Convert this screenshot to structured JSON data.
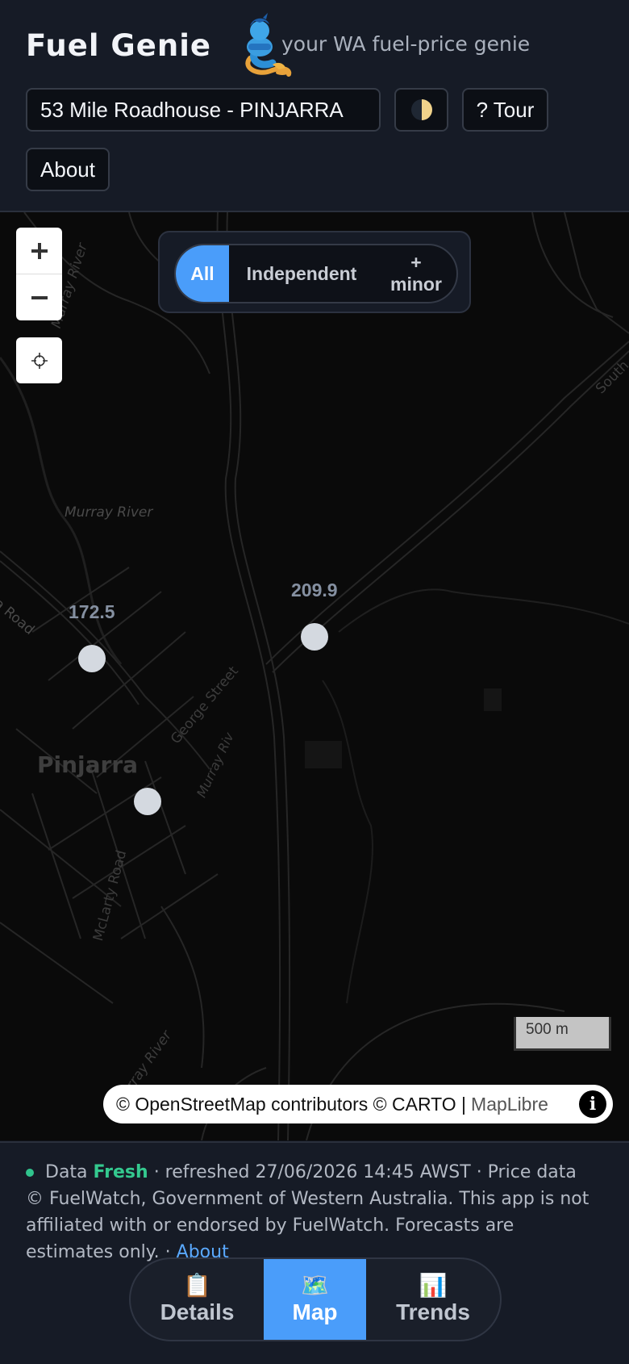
{
  "header": {
    "title": "Fuel Genie",
    "tagline": "your WA fuel-price genie",
    "station_value": "53 Mile Roadhouse - PINJARRA",
    "theme_icon": "half-moon-icon",
    "tour_label": "? Tour",
    "about_label": "About"
  },
  "filter": {
    "options": [
      "All",
      "Independent",
      "+",
      "minor"
    ],
    "selected": "All"
  },
  "map": {
    "labels": {
      "river_north": "Murray River",
      "river_mid": "Murray River",
      "road_west": "Pinjarra Road",
      "town": "Pinjarra",
      "street": "George Street",
      "river_centre": "Murray Riv",
      "road_south": "McLarty Road",
      "river_south": "Murray River",
      "road_east": "South"
    },
    "stations": [
      {
        "price": "172.5"
      },
      {
        "price": "209.9"
      },
      {
        "price": ""
      }
    ],
    "scale_label": "500 m",
    "attribution": "© OpenStreetMap contributors © CARTO |",
    "attribution_link": "MapLibre",
    "info_label": "i"
  },
  "footer": {
    "status_prefix": "Data",
    "status_fresh": "Fresh",
    "status_text": "· refreshed 27/06/2026 14:45 AWST · Price data © FuelWatch, Government of Western Australia. This app is not affiliated with or endorsed by FuelWatch. Forecasts are estimates only. ·",
    "about_link": "About"
  },
  "tabs": [
    {
      "label": "Details",
      "icon": "📋",
      "active": false
    },
    {
      "label": "Map",
      "icon": "🗺️",
      "active": true
    },
    {
      "label": "Trends",
      "icon": "📊",
      "active": false
    }
  ],
  "colors": {
    "accent": "#4a9dfa",
    "fresh": "#34c98f",
    "background": "#0f131b"
  }
}
